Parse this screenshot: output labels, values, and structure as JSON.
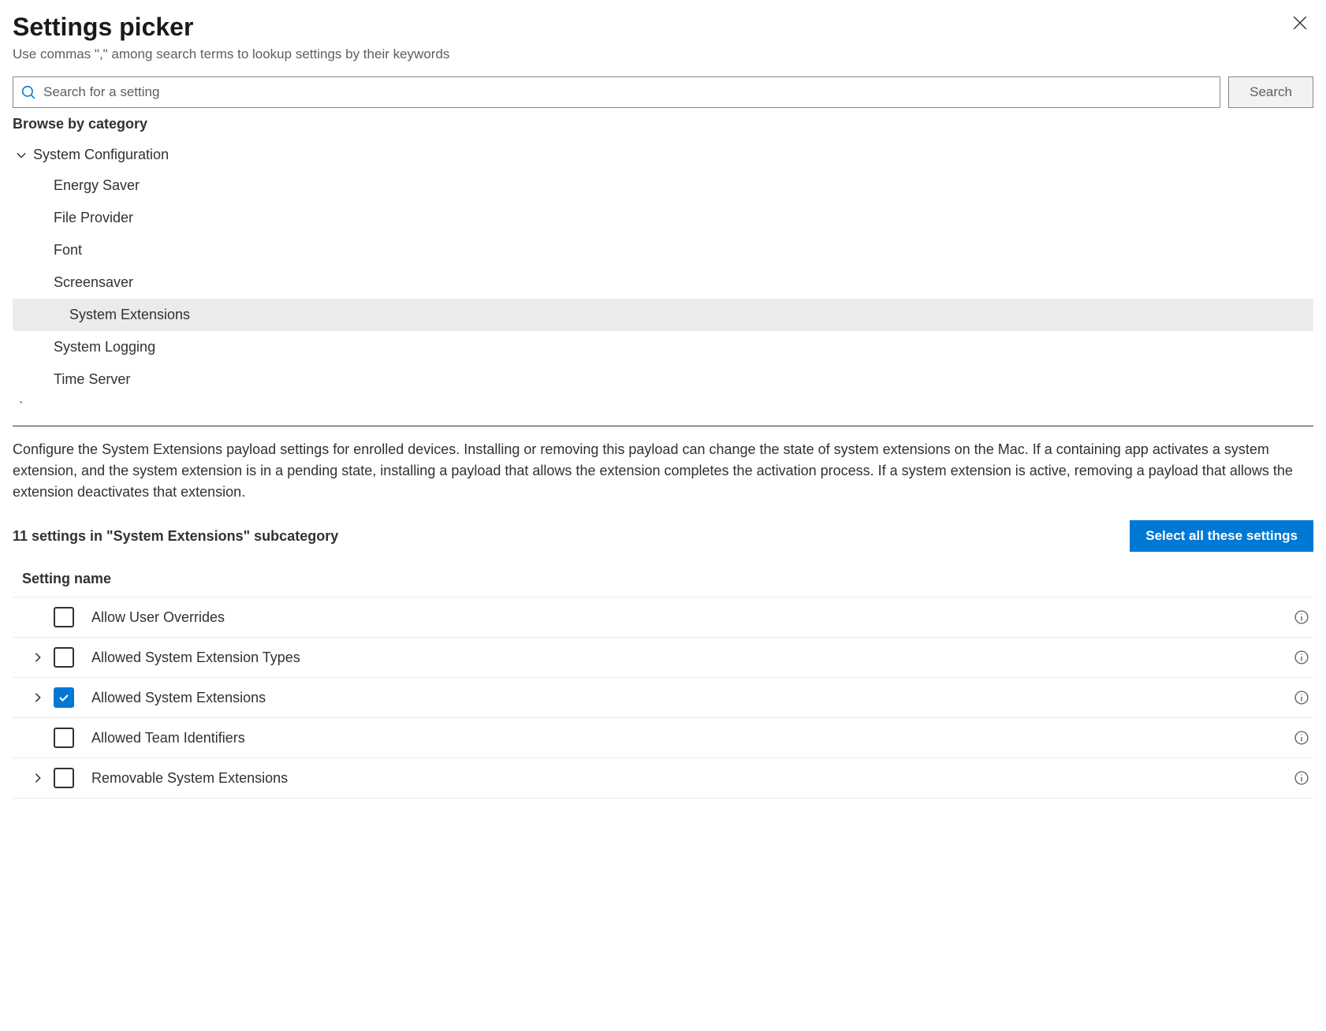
{
  "header": {
    "title": "Settings picker",
    "subtitle": "Use commas \",\" among search terms to lookup settings by their keywords"
  },
  "search": {
    "placeholder": "Search for a setting",
    "button_label": "Search"
  },
  "browse": {
    "heading": "Browse by category",
    "parent": "System Configuration",
    "items": [
      {
        "label": "Energy Saver",
        "selected": false
      },
      {
        "label": "File Provider",
        "selected": false
      },
      {
        "label": "Font",
        "selected": false
      },
      {
        "label": "Screensaver",
        "selected": false
      },
      {
        "label": "System Extensions",
        "selected": true
      },
      {
        "label": "System Logging",
        "selected": false
      },
      {
        "label": "Time Server",
        "selected": false
      }
    ]
  },
  "description": "Configure the System Extensions payload settings for enrolled devices. Installing or removing this payload can change the state of system extensions on the Mac. If a containing app activates a system extension, and the system extension is in a pending state, installing a payload that allows the extension completes the activation process. If a system extension is active, removing a payload that allows the extension deactivates that extension.",
  "subcat": {
    "count_text": "11 settings in \"System Extensions\" subcategory",
    "select_all_label": "Select all these settings"
  },
  "table": {
    "column_header": "Setting name",
    "rows": [
      {
        "label": "Allow User Overrides",
        "expandable": false,
        "checked": false
      },
      {
        "label": "Allowed System Extension Types",
        "expandable": true,
        "checked": false
      },
      {
        "label": "Allowed System Extensions",
        "expandable": true,
        "checked": true
      },
      {
        "label": "Allowed Team Identifiers",
        "expandable": false,
        "checked": false
      },
      {
        "label": "Removable System Extensions",
        "expandable": true,
        "checked": false
      }
    ]
  }
}
